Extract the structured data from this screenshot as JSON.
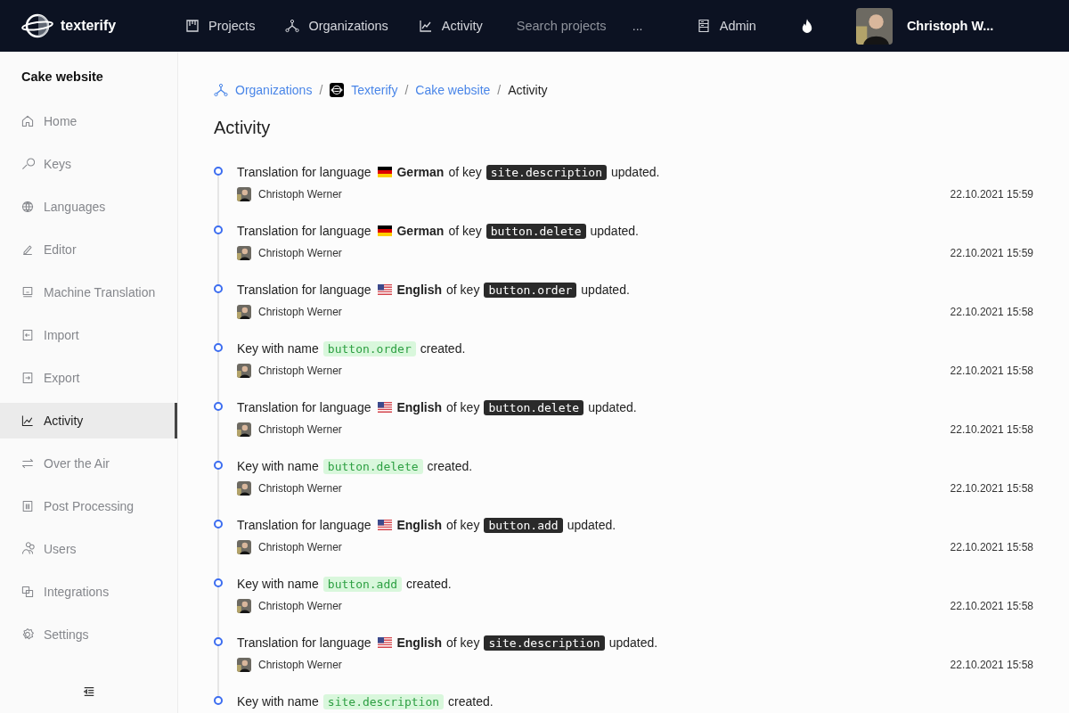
{
  "header": {
    "logo": "texterify",
    "nav": [
      {
        "label": "Projects",
        "selected": false
      },
      {
        "label": "Organizations",
        "selected": false
      },
      {
        "label": "Activity",
        "selected": false
      }
    ],
    "search": {
      "placeholder": "Search projects"
    },
    "search_more": "...",
    "admin": "Admin",
    "user": "Christoph W..."
  },
  "sidebar": {
    "title": "Cake website",
    "items": [
      {
        "label": "Home",
        "selected": false
      },
      {
        "label": "Keys",
        "selected": false
      },
      {
        "label": "Languages",
        "selected": false
      },
      {
        "label": "Editor",
        "selected": false
      },
      {
        "label": "Machine Translation",
        "selected": false
      },
      {
        "label": "Import",
        "selected": false
      },
      {
        "label": "Export",
        "selected": false
      },
      {
        "label": "Activity",
        "selected": true
      },
      {
        "label": "Over the Air",
        "selected": false
      },
      {
        "label": "Post Processing",
        "selected": false
      },
      {
        "label": "Users",
        "selected": false
      },
      {
        "label": "Integrations",
        "selected": false
      },
      {
        "label": "Settings",
        "selected": false
      }
    ]
  },
  "breadcrumb": [
    {
      "label": "Organizations",
      "kind": "organizations"
    },
    {
      "separator": "/",
      "label": "Texterify",
      "kind": "organization"
    },
    {
      "separator": "/",
      "label": "Cake website",
      "kind": "project"
    },
    {
      "separator": "/",
      "label": "Activity",
      "kind": "current"
    }
  ],
  "title": "Activity",
  "activities": [
    {
      "kind": "translation",
      "text_before": "Translation for language",
      "language": {
        "kind": "de",
        "name": "German"
      },
      "text_middle": "of key",
      "key": "site.description",
      "text_after": "updated.",
      "user": "Christoph Werner",
      "time": "22.10.2021 15:59"
    },
    {
      "kind": "translation",
      "text_before": "Translation for language",
      "language": {
        "kind": "de",
        "name": "German"
      },
      "text_middle": "of key",
      "key": "button.delete",
      "text_after": "updated.",
      "user": "Christoph Werner",
      "time": "22.10.2021 15:59"
    },
    {
      "kind": "translation",
      "text_before": "Translation for language",
      "language": {
        "kind": "us",
        "name": "English"
      },
      "text_middle": "of key",
      "key": "button.order",
      "text_after": "updated.",
      "user": "Christoph Werner",
      "time": "22.10.2021 15:58"
    },
    {
      "kind": "key_created",
      "text_before": "Key with name",
      "key": "button.order",
      "text_after": "created.",
      "user": "Christoph Werner",
      "time": "22.10.2021 15:58"
    },
    {
      "kind": "translation",
      "text_before": "Translation for language",
      "language": {
        "kind": "us",
        "name": "English"
      },
      "text_middle": "of key",
      "key": "button.delete",
      "text_after": "updated.",
      "user": "Christoph Werner",
      "time": "22.10.2021 15:58"
    },
    {
      "kind": "key_created",
      "text_before": "Key with name",
      "key": "button.delete",
      "text_after": "created.",
      "user": "Christoph Werner",
      "time": "22.10.2021 15:58"
    },
    {
      "kind": "translation",
      "text_before": "Translation for language",
      "language": {
        "kind": "us",
        "name": "English"
      },
      "text_middle": "of key",
      "key": "button.add",
      "text_after": "updated.",
      "user": "Christoph Werner",
      "time": "22.10.2021 15:58"
    },
    {
      "kind": "key_created",
      "text_before": "Key with name",
      "key": "button.add",
      "text_after": "created.",
      "user": "Christoph Werner",
      "time": "22.10.2021 15:58"
    },
    {
      "kind": "translation",
      "text_before": "Translation for language",
      "language": {
        "kind": "us",
        "name": "English"
      },
      "text_middle": "of key",
      "key": "site.description",
      "text_after": "updated.",
      "user": "Christoph Werner",
      "time": "22.10.2021 15:58"
    },
    {
      "kind": "key_created",
      "text_before": "Key with name",
      "key": "site.description",
      "text_after": "created."
    }
  ]
}
